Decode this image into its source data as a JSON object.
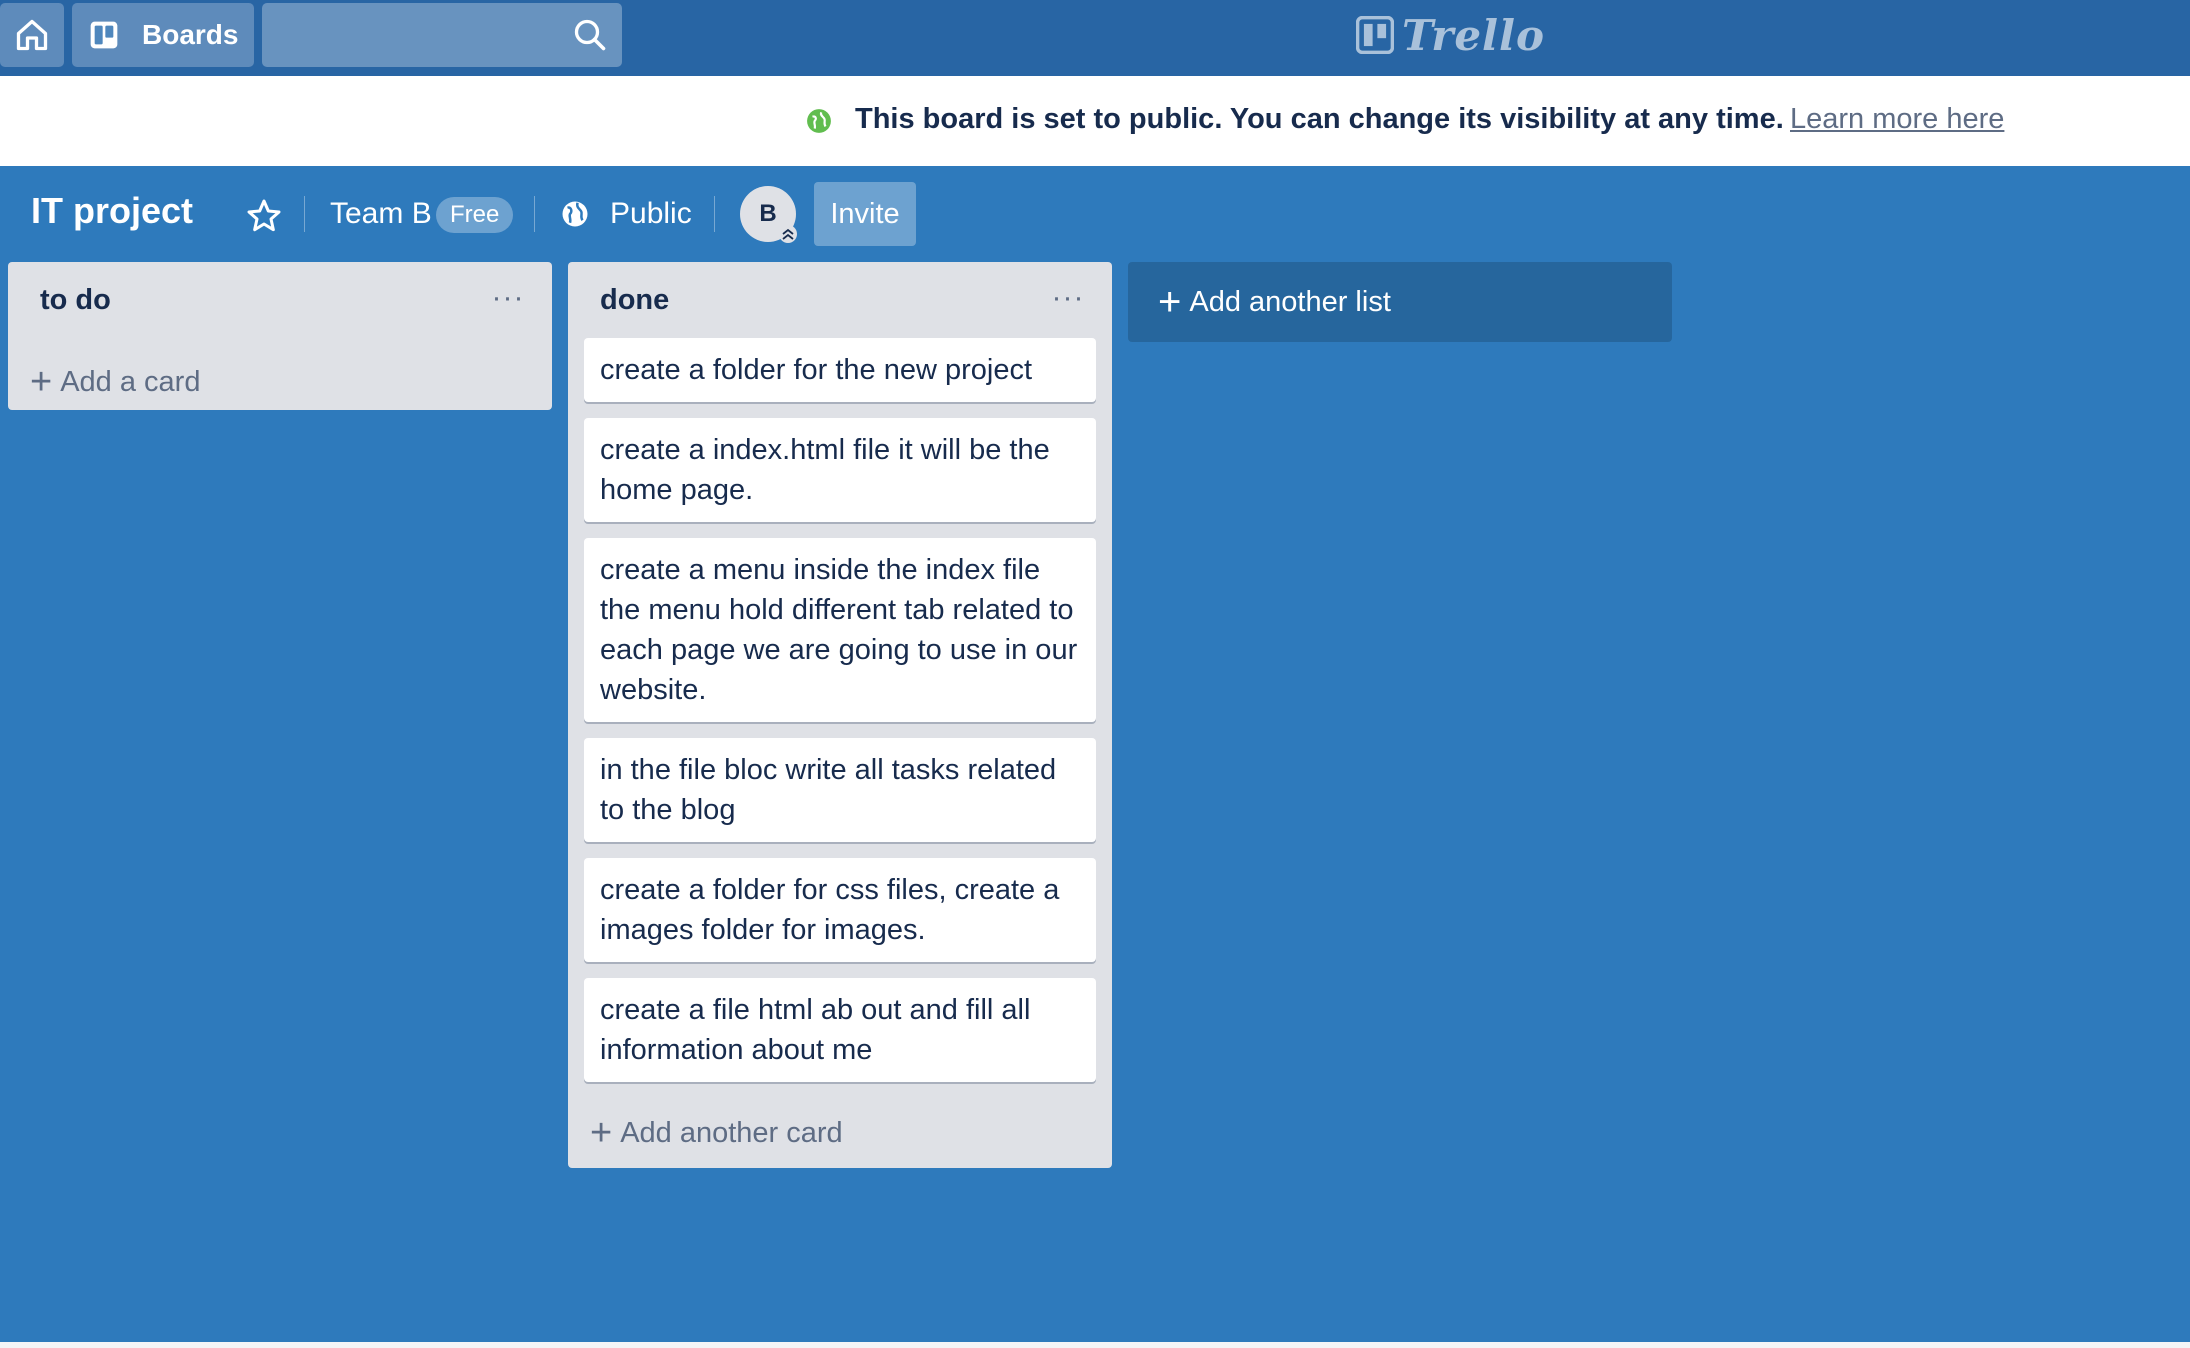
{
  "header": {
    "home_icon": "home-icon",
    "boards_label": "Boards",
    "boards_icon": "board-icon",
    "search": {
      "value": "",
      "placeholder": "",
      "icon": "search-icon"
    },
    "logo_text": "Trello"
  },
  "banner": {
    "icon": "globe-icon",
    "message": "This board is set to public. You can change its visibility at any time.",
    "link": "Learn more here"
  },
  "board": {
    "title": "IT project",
    "star_icon": "star-icon",
    "team": "Team B",
    "team_badge": "Free",
    "visibility_icon": "globe-icon",
    "visibility": "Public",
    "member_initial": "B",
    "invite_label": "Invite"
  },
  "lists": [
    {
      "title": "to do",
      "menu": "···",
      "cards": [],
      "add_label": "Add a card"
    },
    {
      "title": "done",
      "menu": "···",
      "cards": [
        "create a folder for the new project",
        "create a index.html file it will be the home page.",
        "create a menu inside the index file the menu hold different tab related to each page we are going to use in our website.",
        "in the file bloc write all tasks related to the blog",
        "create a folder for css files, create a images folder for images.",
        "create a file html ab out and fill all information about me"
      ],
      "add_label": "Add another card"
    }
  ],
  "add_list_label": "Add another list",
  "colors": {
    "board_bg": "#2e7abc",
    "header_bg": "#2865a4",
    "list_bg": "#dfe1e6",
    "banner_globe": "#61bd4f"
  }
}
